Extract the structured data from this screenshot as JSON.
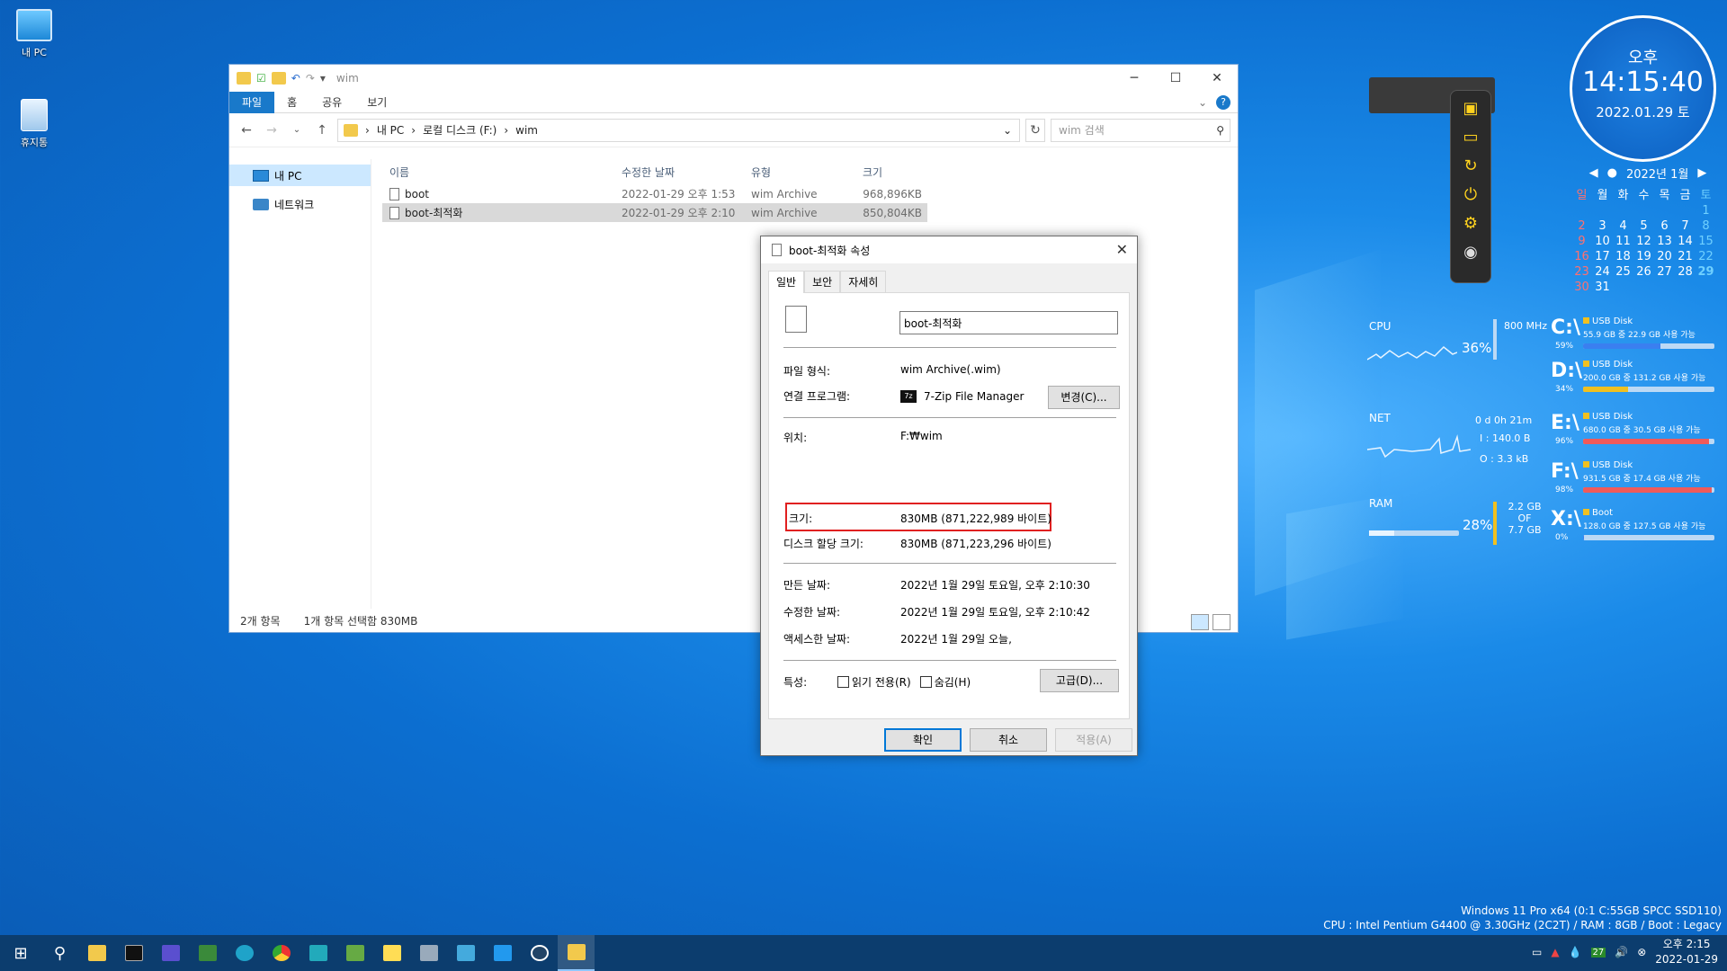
{
  "desktop": {
    "icons": [
      {
        "label": "내 PC"
      },
      {
        "label": "휴지통"
      }
    ]
  },
  "explorer": {
    "title": "wim",
    "window_controls": [
      "─",
      "☐",
      "✕"
    ],
    "ribbon_tabs": [
      "파일",
      "홈",
      "공유",
      "보기"
    ],
    "breadcrumb": [
      "내 PC",
      "로컬 디스크 (F:)",
      "wim"
    ],
    "search_placeholder": "wim 검색",
    "nav": [
      {
        "label": "내 PC"
      },
      {
        "label": "네트워크"
      }
    ],
    "columns": [
      "이름",
      "수정한 날짜",
      "유형",
      "크기"
    ],
    "files": [
      {
        "name": "boot",
        "date": "2022-01-29 오후 1:53",
        "type": "wim Archive",
        "size": "968,896KB"
      },
      {
        "name": "boot-최적화",
        "date": "2022-01-29 오후 2:10",
        "type": "wim Archive",
        "size": "850,804KB"
      }
    ],
    "status": {
      "count": "2개 항목",
      "selected": "1개 항목 선택함 830MB"
    }
  },
  "dialog": {
    "title": "boot-최적화 속성",
    "tabs": [
      "일반",
      "보안",
      "자세히"
    ],
    "filename": "boot-최적화",
    "rows": {
      "type_label": "파일 형식:",
      "type_value": "wim Archive(.wim)",
      "opens_label": "연결 프로그램:",
      "opens_value": "7-Zip File Manager",
      "change_btn": "변경(C)...",
      "loc_label": "위치:",
      "loc_value": "F:₩wim",
      "size_label": "크기:",
      "size_value": "830MB (871,222,989 바이트)",
      "disk_label": "디스크 할당 크기:",
      "disk_value": "830MB (871,223,296 바이트)",
      "created_label": "만든 날짜:",
      "created_value": "2022년 1월 29일 토요일, 오후 2:10:30",
      "modified_label": "수정한 날짜:",
      "modified_value": "2022년 1월 29일 토요일, 오후 2:10:42",
      "accessed_label": "액세스한 날짜:",
      "accessed_value": "2022년 1월 29일 오늘,",
      "attr_label": "특성:",
      "readonly": "읽기 전용(R)",
      "hidden": "숨김(H)",
      "advanced": "고급(D)..."
    },
    "buttons": {
      "ok": "확인",
      "cancel": "취소",
      "apply": "적용(A)"
    }
  },
  "clock": {
    "ampm": "오후",
    "time": "14:15:40",
    "date": "2022.01.29 토"
  },
  "calendar": {
    "header": "2022년 1월",
    "weekdays": [
      "일",
      "월",
      "화",
      "수",
      "목",
      "금",
      "토"
    ],
    "days": [
      "",
      "",
      "",
      "",
      "",
      "",
      "1",
      "2",
      "3",
      "4",
      "5",
      "6",
      "7",
      "8",
      "9",
      "10",
      "11",
      "12",
      "13",
      "14",
      "15",
      "16",
      "17",
      "18",
      "19",
      "20",
      "21",
      "22",
      "23",
      "24",
      "25",
      "26",
      "27",
      "28",
      "29",
      "30",
      "31"
    ]
  },
  "meters": {
    "cpu_label": "CPU",
    "cpu_pct": "36%",
    "cpu_freq": "800 MHz",
    "net_label": "NET",
    "net_uptime": "0 d 0h 21m",
    "net_in": "I : 140.0 B",
    "net_out": "O : 3.3 kB",
    "ram_label": "RAM",
    "ram_pct": "28%",
    "ram_used": "2.2 GB",
    "ram_of": "OF",
    "ram_total": "7.7 GB"
  },
  "drives": [
    {
      "letter": "C:\\",
      "name": "USB Disk",
      "info": "55.9 GB 중 22.9 GB 사용 가능",
      "pct": "59%",
      "fill": 0.59,
      "color": "#3a7ff0"
    },
    {
      "letter": "D:\\",
      "name": "USB Disk",
      "info": "200.0 GB 중 131.2 GB 사용 가능",
      "pct": "34%",
      "fill": 0.34,
      "color": "#f0c020"
    },
    {
      "letter": "E:\\",
      "name": "USB Disk",
      "info": "680.0 GB 중 30.5 GB 사용 가능",
      "pct": "96%",
      "fill": 0.96,
      "color": "#f05a5a"
    },
    {
      "letter": "F:\\",
      "name": "USB Disk",
      "info": "931.5 GB 중 17.4 GB 사용 가능",
      "pct": "98%",
      "fill": 0.98,
      "color": "#f05a5a"
    },
    {
      "letter": "X:\\",
      "name": "Boot",
      "info": "128.0 GB 중 127.5 GB 사용 가능",
      "pct": "0%",
      "fill": 0.01,
      "color": "#3a7ff0"
    }
  ],
  "sysinfo": {
    "line1": "Windows 11 Pro x64 (0:1 C:55GB SPCC SSD110)",
    "line2": "CPU : Intel Pentium G4400 @ 3.30GHz (2C2T) / RAM : 8GB / Boot : Legacy"
  },
  "taskbar": {
    "time": "오후 2:15",
    "date": "2022-01-29",
    "badge": "27"
  }
}
